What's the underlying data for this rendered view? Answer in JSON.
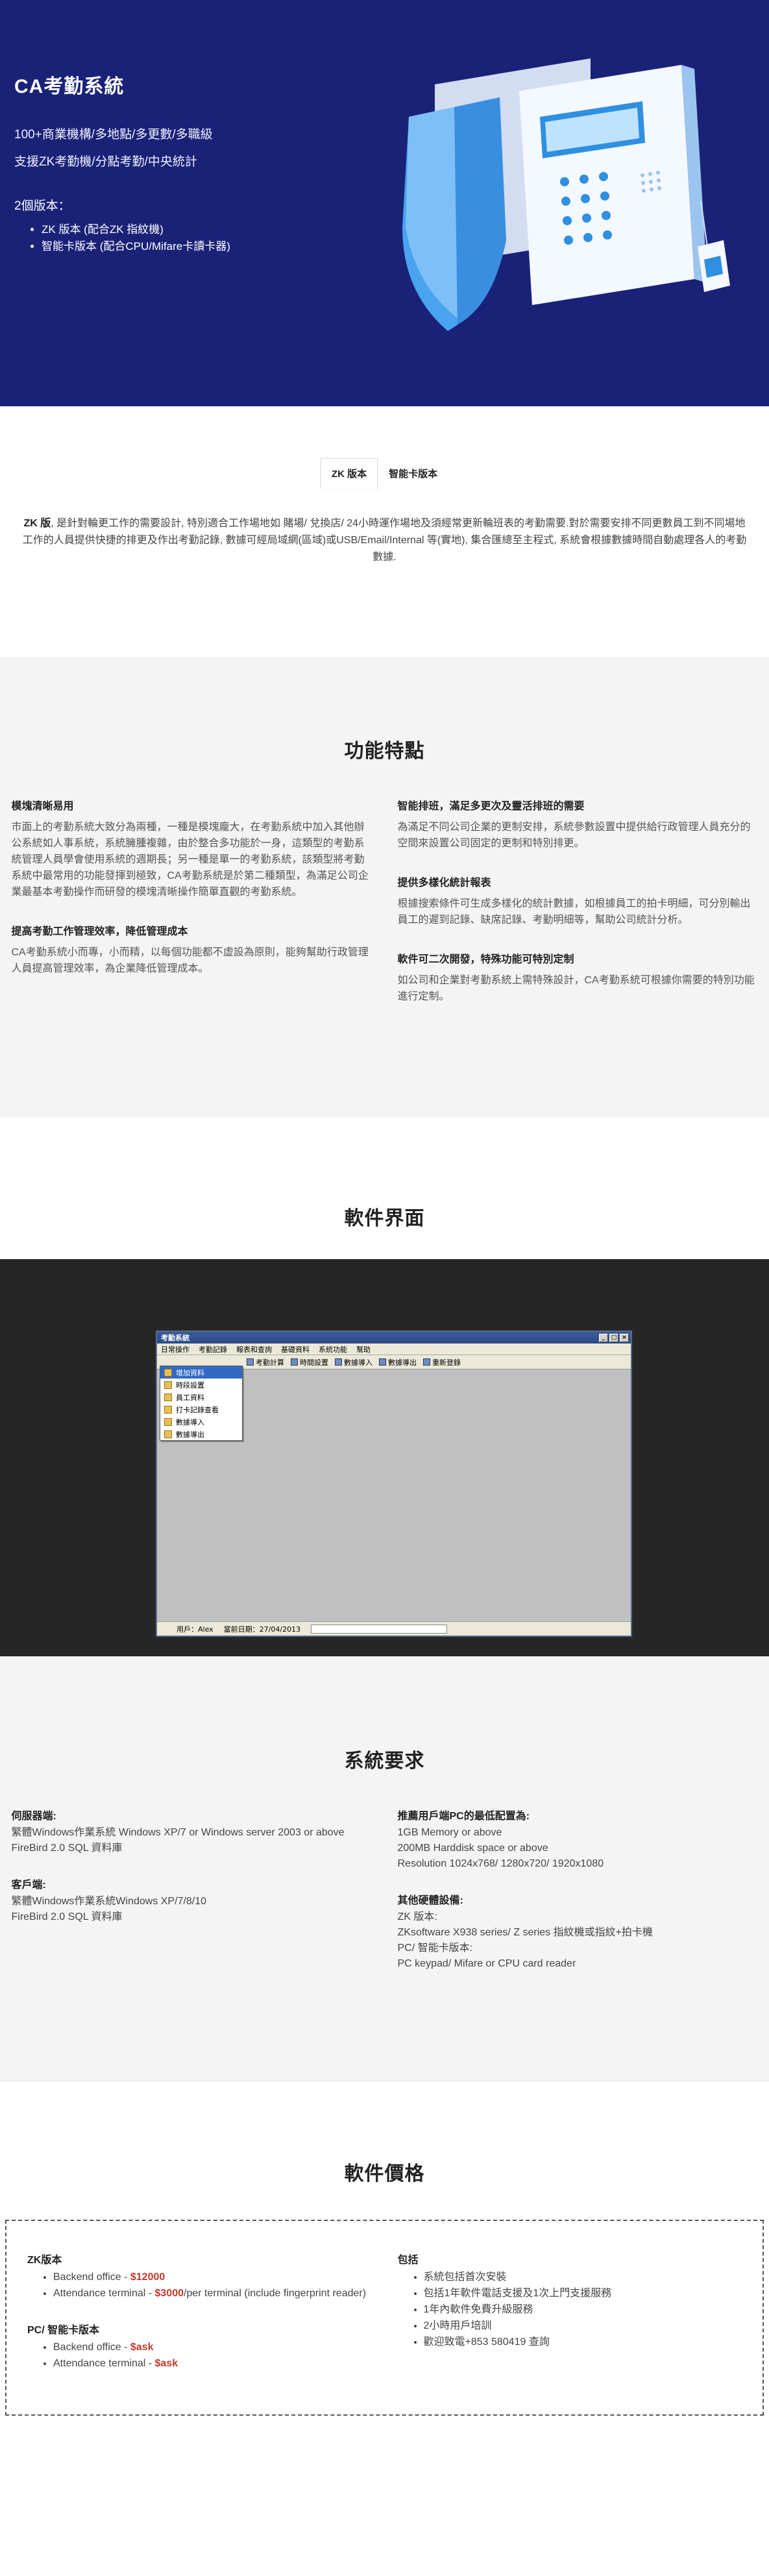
{
  "hero": {
    "title": "CA考勤系統",
    "line1": "100+商業機構/多地點/多更數/多職級",
    "line2": "支援ZK考勤機/分點考勤/中央統計",
    "versions_label": "2個版本：",
    "versions": [
      "ZK 版本 (配合ZK 指紋機)",
      "智能卡版本 (配合CPU/Mifare卡讀卡器)"
    ]
  },
  "tabs": [
    "ZK 版本",
    "智能卡版本"
  ],
  "intro": {
    "bold": "ZK 版",
    "text": ", 是針對輪更工作的需要設計, 特別適合工作場地如 賭場/ 兌換店/ 24小時運作場地及須經常更新輪班表的考勤需要.對於需要安排不同更數員工到不同場地工作的人員提供快捷的排更及作出考勤記錄, 數據可經局域網(區域)或USB/Email/Internal 等(實地), 集合匯總至主程式, 系統會根據數據時間自動處理各人的考勤數據."
  },
  "features": {
    "title": "功能特點",
    "left": [
      {
        "heading": "模塊清晰易用",
        "text": "市面上的考勤系統大致分為兩種，一種是模塊龐大，在考勤系統中加入其他辦公系統如人事系統，系統臃腫複雜，由於整合多功能於一身，這類型的考勤系統管理人員學會使用系統的週期長；另一種是單一的考勤系統，該類型將考勤系統中最常用的功能發揮到極致，CA考勤系統是於第二種類型，為滿足公司企業最基本考勤操作而研發的模塊清晰操作簡單直觀的考勤系統。"
      },
      {
        "heading": "提高考勤工作管理效率，降低管理成本",
        "text": "CA考勤系統小而專，小而精，以每個功能都不虛設為原則，能夠幫助行政管理人員提高管理效率，為企業降低管理成本。"
      }
    ],
    "right": [
      {
        "heading": "智能排班，滿足多更次及靈活排班的需要",
        "text": "為滿足不同公司企業的更制安排，系統參數設置中提供給行政管理人員充分的空間來設置公司固定的更制和特別排更。"
      },
      {
        "heading": "提供多樣化統計報表",
        "text": "根據搜索條件可生成多樣化的統計數據，如根據員工的拍卡明細，可分別輸出員工的遲到記錄、缺席記錄、考勤明細等，幫助公司統計分析。"
      },
      {
        "heading": "軟件可二次開發，特殊功能可特別定制",
        "text": "如公司和企業對考勤系統上需特殊設計，CA考勤系統可根據你需要的特別功能進行定制。"
      }
    ]
  },
  "software": {
    "title": "軟件界面",
    "window_title": "考勤系統",
    "menu": [
      "日常操作",
      "考勤記錄",
      "報表和查詢",
      "基礎資料",
      "系統功能",
      "幫助"
    ],
    "toolbar": [
      "考勤計算",
      "時間設置",
      "數據導入",
      "數據導出",
      "重新登錄"
    ],
    "dropdown": [
      "增加資料",
      "時段設置",
      "員工資料",
      "打卡記錄查看",
      "數據導入",
      "數據導出"
    ],
    "status_user": "用戶：Alex",
    "status_date": "當前日期：27/04/2013"
  },
  "requirements": {
    "title": "系統要求",
    "left": [
      {
        "heading": "伺服器端:",
        "text": "繁體Windows作業系統 Windows XP/7 or Windows server 2003 or above\nFireBird 2.0 SQL 資料庫"
      },
      {
        "heading": "客戶端:",
        "text": "繁體Windows作業系統Windows XP/7/8/10\nFireBird 2.0 SQL 資料庫"
      }
    ],
    "right": [
      {
        "heading": "推薦用戶端PC的最低配置為:",
        "text": "1GB Memory or above\n200MB Harddisk space or above\nResolution 1024x768/ 1280x720/ 1920x1080"
      },
      {
        "heading": "其他硬體設備:",
        "text": "ZK 版本:\nZKsoftware X938 series/ Z series 指紋機或指紋+拍卡機\nPC/ 智能卡版本:\nPC keypad/ Mifare or CPU card reader"
      }
    ]
  },
  "pricing": {
    "title": "軟件價格",
    "zk_heading": "ZK版本",
    "zk_items": [
      {
        "label": "Backend office - ",
        "price": "$12000",
        "suffix": ""
      },
      {
        "label": "Attendance terminal - ",
        "price": "$3000",
        "suffix": "/per terminal (include fingerprint reader)"
      }
    ],
    "pc_heading": "PC/ 智能卡版本",
    "pc_items": [
      {
        "label": "Backend office - ",
        "price": "$ask",
        "suffix": ""
      },
      {
        "label": "Attendance terminal - ",
        "price": "$ask",
        "suffix": ""
      }
    ],
    "include_heading": "包括",
    "include_items": [
      "系統包括首次安裝",
      "包括1年軟件電話支援及1次上門支援服務",
      "1年內軟件免費升級服務",
      "2小時用戶培訓",
      "歡迎致電+853 580419 查詢"
    ]
  },
  "colors": {
    "hero_bg": "#1a2278",
    "price_red": "#c0392b"
  }
}
